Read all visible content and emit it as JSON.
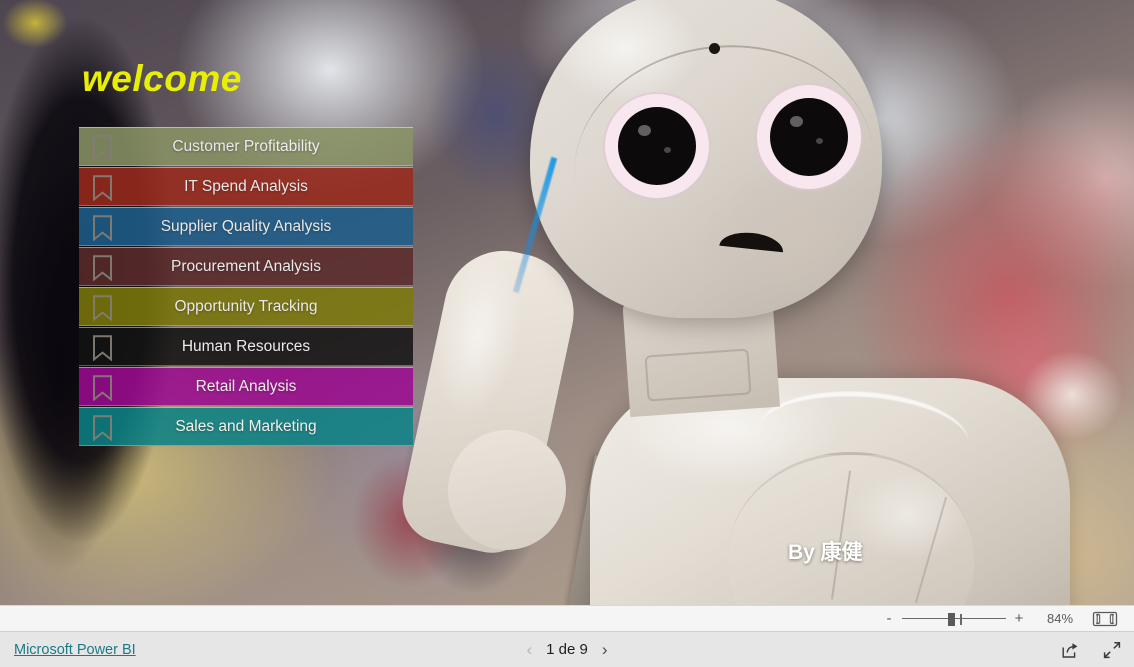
{
  "report": {
    "title": "welcome",
    "credit": "By 康健",
    "background_icon": "pepper-robot-photo"
  },
  "nav": {
    "items": [
      {
        "label": "Customer Profitability",
        "color": "#8a9466",
        "icon": "bookmark-icon"
      },
      {
        "label": "IT Spend Analysis",
        "color": "#9b2a1c",
        "icon": "bookmark-icon"
      },
      {
        "label": "Supplier Quality Analysis",
        "color": "#1e5f8c",
        "icon": "bookmark-icon"
      },
      {
        "label": "Procurement Analysis",
        "color": "#5c2b2b",
        "icon": "bookmark-icon"
      },
      {
        "label": "Opportunity Tracking",
        "color": "#7d7a0b",
        "icon": "bookmark-icon"
      },
      {
        "label": "Human Resources",
        "color": "#131313",
        "icon": "bookmark-icon"
      },
      {
        "label": "Retail Analysis",
        "color": "#9c0a91",
        "icon": "bookmark-icon"
      },
      {
        "label": "Sales and Marketing",
        "color": "#0b8286",
        "icon": "bookmark-icon"
      }
    ]
  },
  "zoom_bar": {
    "minus_label": "-",
    "plus_label": "+",
    "percent": "84%",
    "slider_value": 84,
    "fit_icon": "fit-to-page-icon"
  },
  "footer": {
    "brand_link": "Microsoft Power BI",
    "brand_link_color": "#1a7a84",
    "prev_label": "‹",
    "next_label": "›",
    "page_label": "1 de 9",
    "current_page": 1,
    "total_pages": 9,
    "share_icon": "share-icon",
    "fullscreen_icon": "fullscreen-expand-icon"
  }
}
